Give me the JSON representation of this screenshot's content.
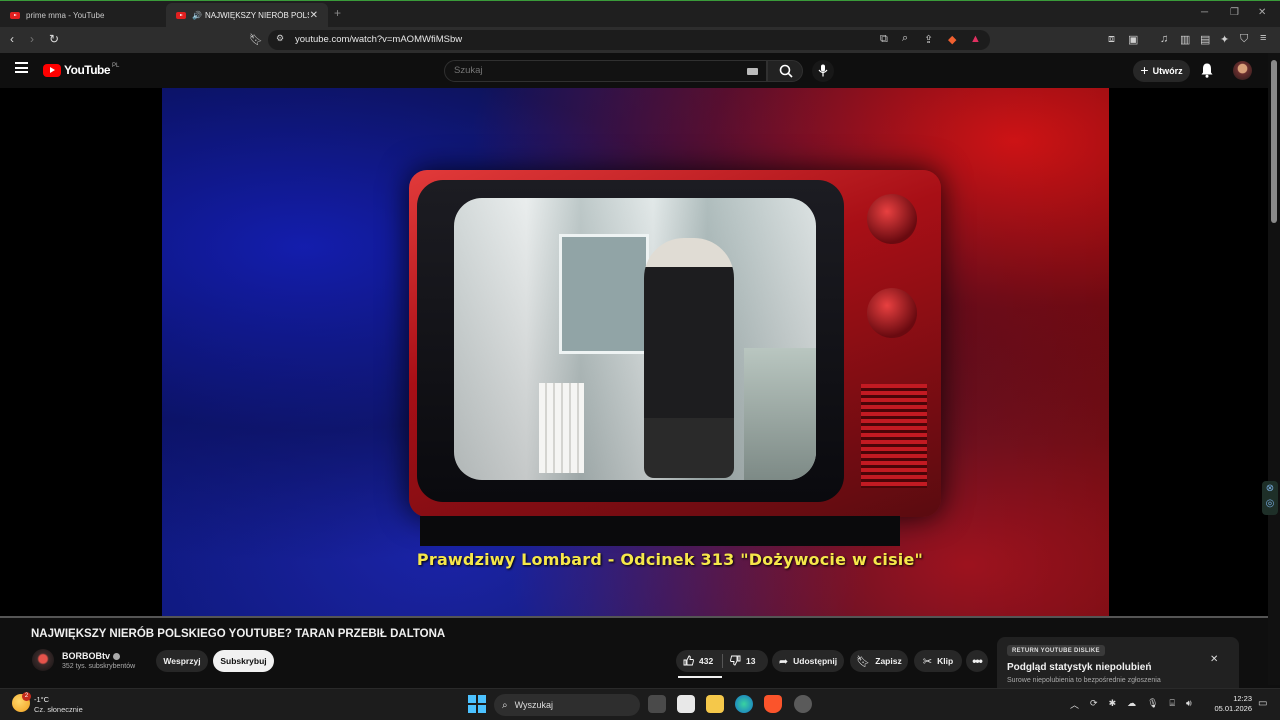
{
  "browser": {
    "tabs": [
      {
        "label": "prime mma - YouTube"
      },
      {
        "label": "NAJWIĘKSZY NIERÓB POLSKI"
      }
    ],
    "url": "youtube.com/watch?v=mAOMWfiMSbw"
  },
  "yt_header": {
    "logo_text": "YouTube",
    "region": "PL",
    "search_placeholder": "Szukaj",
    "create_label": "Utwórz"
  },
  "video": {
    "subtitle": "Prawdziwy Lombard - Odcinek 313 \"Dożywocie w cisie\"",
    "progress_fraction": 0.0
  },
  "details": {
    "title": "NAJWIĘKSZY NIERÓB POLSKIEGO YOUTUBE? TARAN PRZEBIŁ DALTONA",
    "channel": "BORBOBtv",
    "subscribers": "352 tys. subskrybentów",
    "support_label": "Wesprzyj",
    "subscribe_label": "Subskrybuj",
    "likes": "432",
    "dislikes": "13",
    "share_label": "Udostępnij",
    "save_label": "Zapisz",
    "clip_label": "Klip"
  },
  "ryd_card": {
    "badge": "RETURN YOUTUBE DISLIKE",
    "heading": "Podgląd statystyk niepolubień",
    "subtext": "Surowe niepolubienia to bezpośrednie zgłoszenia"
  },
  "taskbar": {
    "temperature": "-1°C",
    "weather": "Cz. słonecznie",
    "search_label": "Wyszukaj",
    "time": "12:23",
    "date": "05.01.2026",
    "weather_badge": "2"
  },
  "colors": {
    "accent_red": "#ff0000",
    "subtitle_yellow": "#f6e74a",
    "taskbar_blue": "#4cc2ff"
  }
}
